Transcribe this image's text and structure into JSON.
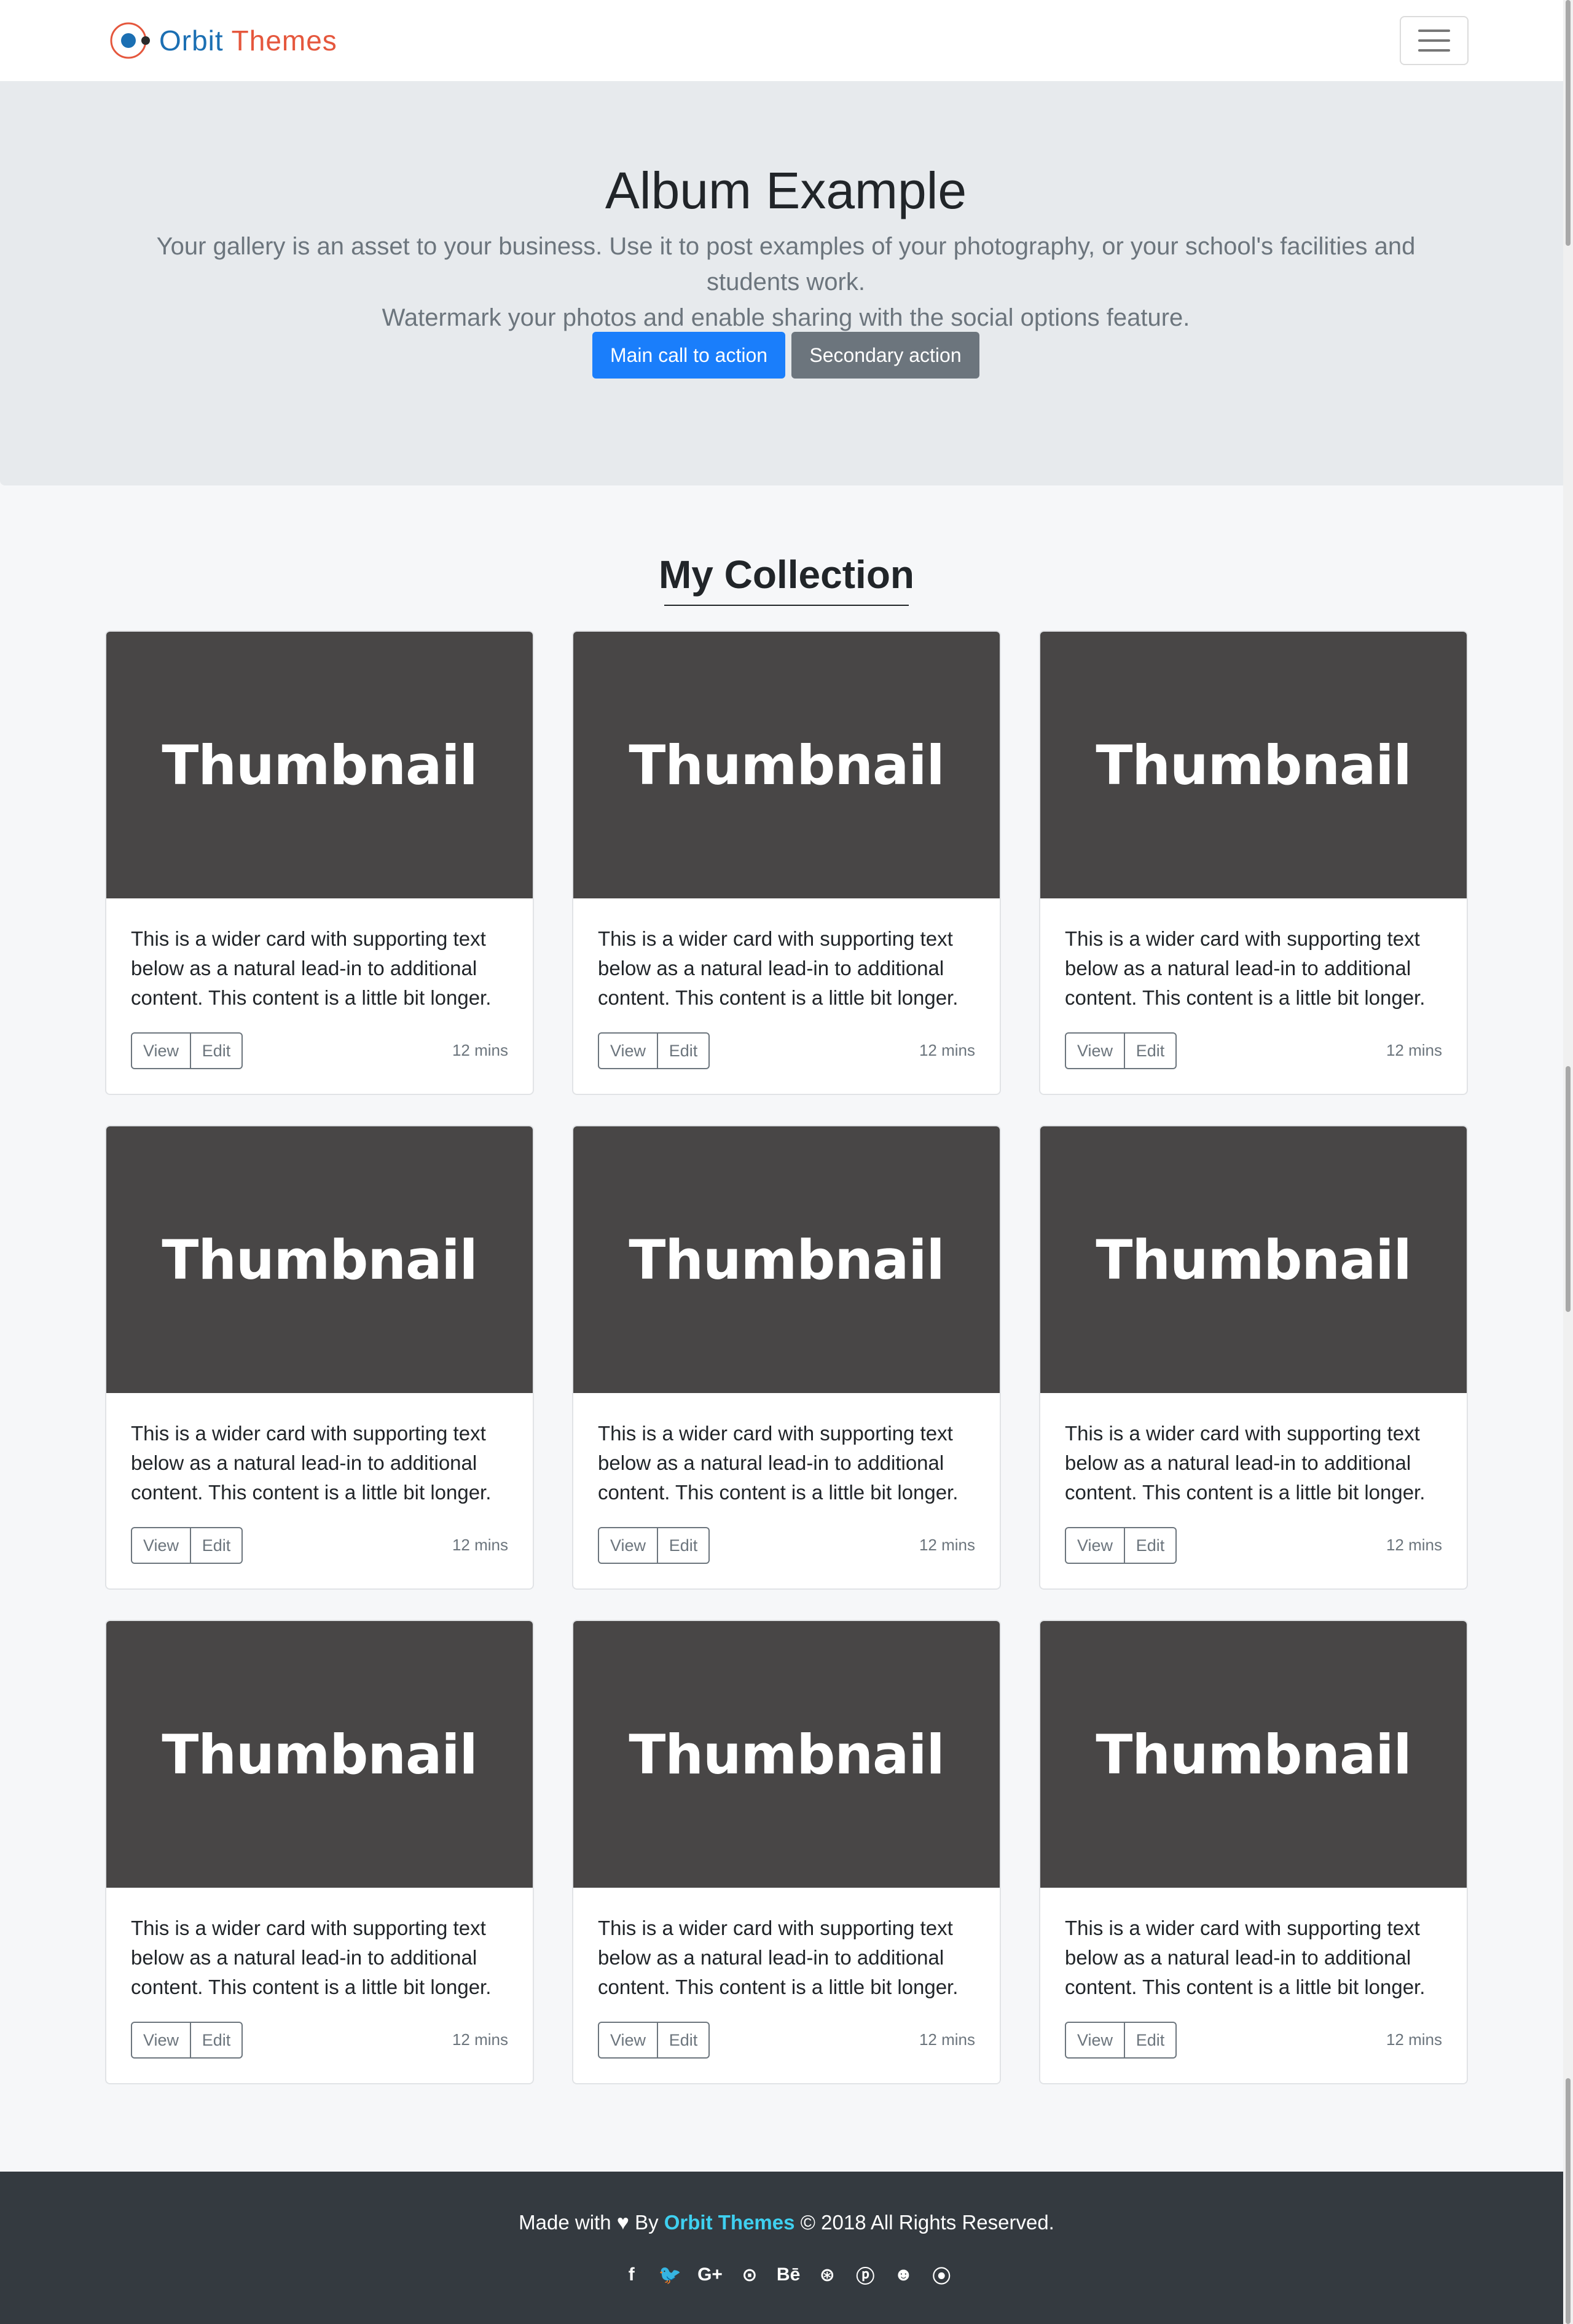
{
  "navbar": {
    "brand_word1": "Orbit",
    "brand_word2": "Themes",
    "toggler_icon": "hamburger-menu-icon"
  },
  "hero": {
    "title": "Album Example",
    "lead_line1": "Your gallery is an asset to your business. Use it to post examples of your photography, or your school's facilities and students work.",
    "lead_line2": "Watermark your photos and enable sharing with the social options feature.",
    "primary_button": "Main call to action",
    "secondary_button": "Secondary action"
  },
  "collection": {
    "title": "My Collection",
    "cards": [
      {
        "thumb": "Thumbnail",
        "text": "This is a wider card with supporting text below as a natural lead-in to additional content. This content is a little bit longer.",
        "view": "View",
        "edit": "Edit",
        "time": "12 mins"
      },
      {
        "thumb": "Thumbnail",
        "text": "This is a wider card with supporting text below as a natural lead-in to additional content. This content is a little bit longer.",
        "view": "View",
        "edit": "Edit",
        "time": "12 mins"
      },
      {
        "thumb": "Thumbnail",
        "text": "This is a wider card with supporting text below as a natural lead-in to additional content. This content is a little bit longer.",
        "view": "View",
        "edit": "Edit",
        "time": "12 mins"
      },
      {
        "thumb": "Thumbnail",
        "text": "This is a wider card with supporting text below as a natural lead-in to additional content. This content is a little bit longer.",
        "view": "View",
        "edit": "Edit",
        "time": "12 mins"
      },
      {
        "thumb": "Thumbnail",
        "text": "This is a wider card with supporting text below as a natural lead-in to additional content. This content is a little bit longer.",
        "view": "View",
        "edit": "Edit",
        "time": "12 mins"
      },
      {
        "thumb": "Thumbnail",
        "text": "This is a wider card with supporting text below as a natural lead-in to additional content. This content is a little bit longer.",
        "view": "View",
        "edit": "Edit",
        "time": "12 mins"
      },
      {
        "thumb": "Thumbnail",
        "text": "This is a wider card with supporting text below as a natural lead-in to additional content. This content is a little bit longer.",
        "view": "View",
        "edit": "Edit",
        "time": "12 mins"
      },
      {
        "thumb": "Thumbnail",
        "text": "This is a wider card with supporting text below as a natural lead-in to additional content. This content is a little bit longer.",
        "view": "View",
        "edit": "Edit",
        "time": "12 mins"
      },
      {
        "thumb": "Thumbnail",
        "text": "This is a wider card with supporting text below as a natural lead-in to additional content. This content is a little bit longer.",
        "view": "View",
        "edit": "Edit",
        "time": "12 mins"
      }
    ]
  },
  "footer": {
    "made_with": "Made with",
    "by": "By",
    "brand": "Orbit Themes",
    "rights": "© 2018 All Rights Reserved.",
    "social": [
      {
        "icon": "facebook-icon",
        "glyph": "f"
      },
      {
        "icon": "twitter-icon",
        "glyph": "🐦"
      },
      {
        "icon": "google-plus-icon",
        "glyph": "G+"
      },
      {
        "icon": "github-icon",
        "glyph": "⊙"
      },
      {
        "icon": "behance-icon",
        "glyph": "Bē"
      },
      {
        "icon": "dribbble-icon",
        "glyph": "⊛"
      },
      {
        "icon": "pinterest-icon",
        "glyph": "ⓟ"
      },
      {
        "icon": "reddit-icon",
        "glyph": "☻"
      },
      {
        "icon": "rss-icon",
        "glyph": "⦿"
      }
    ]
  },
  "colors": {
    "primary": "#1a7efb",
    "secondary": "#6c757d",
    "brand_blue": "#1b6fb3",
    "brand_red": "#e5573d",
    "thumbnail_bg": "#484646",
    "footer_bg": "#343a40",
    "footer_link": "#3fd0f0"
  }
}
